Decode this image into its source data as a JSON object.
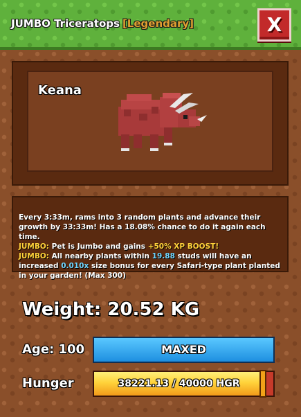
{
  "header": {
    "title": "JUMBO Triceratops",
    "rarity": "[Legendary]",
    "close_label": "X"
  },
  "pet": {
    "name": "Keana",
    "image_icon": "red-triceratops-icon"
  },
  "description": {
    "line1": "Every 3:33m, rams into 3 random plants and advance their growth by 33:33m! Has a 18.08% chance to do it again each time.",
    "jumbo1_prefix": "JUMBO:",
    "jumbo1_text": " Pet is Jumbo and gains ",
    "jumbo1_boost": "+50% XP BOOST!",
    "jumbo2_prefix": "JUMBO:",
    "jumbo2_text_a": " All nearby plants within ",
    "jumbo2_studs": "19.88",
    "jumbo2_text_b": " studs will have an increased ",
    "jumbo2_bonus": "0.010x",
    "jumbo2_text_c": " size bonus for every Safari-type plant planted in your garden! (Max 300)"
  },
  "stats": {
    "weight": "Weight: 20.52 KG",
    "age_label": "Age: 100",
    "age_status": "MAXED",
    "hunger_label": "Hunger",
    "hunger_text": "38221.13 / 40000 HGR",
    "hunger_fraction": 0.9555
  },
  "colors": {
    "rarity": "#e0a030",
    "age_bar": "#2aa3f0",
    "hunger_fill": "#ffd23a",
    "close_button": "#c22a2a"
  }
}
